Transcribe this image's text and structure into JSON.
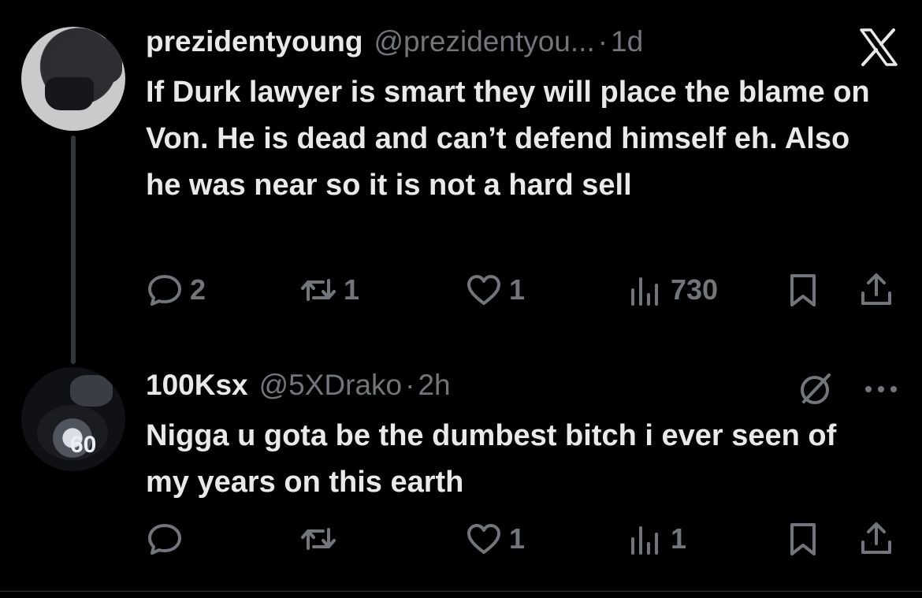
{
  "colors": {
    "background": "#000000",
    "primary_text": "#e7e9ea",
    "secondary_text": "#71767b",
    "thread_line": "#333639"
  },
  "tweets": [
    {
      "name": "prezidentyoung",
      "handle": "@prezidentyou...",
      "separator": "·",
      "time": "1d",
      "text": "If Durk lawyer is smart they will place the blame on Von. He is dead and can’t defend himself eh. Also he was near so it is not a hard sell",
      "replies": "2",
      "reposts": "1",
      "likes": "1",
      "views": "730",
      "icons": [
        "reply-icon",
        "repost-icon",
        "like-icon",
        "views-icon",
        "bookmark-icon",
        "share-icon"
      ]
    },
    {
      "name": "100Ksx",
      "handle": "@5XDrako",
      "separator": "·",
      "time": "2h",
      "text": "Nigga u gota be the dumbest bitch i ever seen of my years on this earth",
      "replies": "",
      "reposts": "",
      "likes": "1",
      "views": "1",
      "icons": [
        "reply-icon",
        "repost-icon",
        "like-icon",
        "views-icon",
        "bookmark-icon",
        "share-icon"
      ]
    }
  ],
  "header_icons": [
    "x-logo-icon",
    "grok-icon",
    "more-icon"
  ],
  "avatar2_overlay_text": "60"
}
